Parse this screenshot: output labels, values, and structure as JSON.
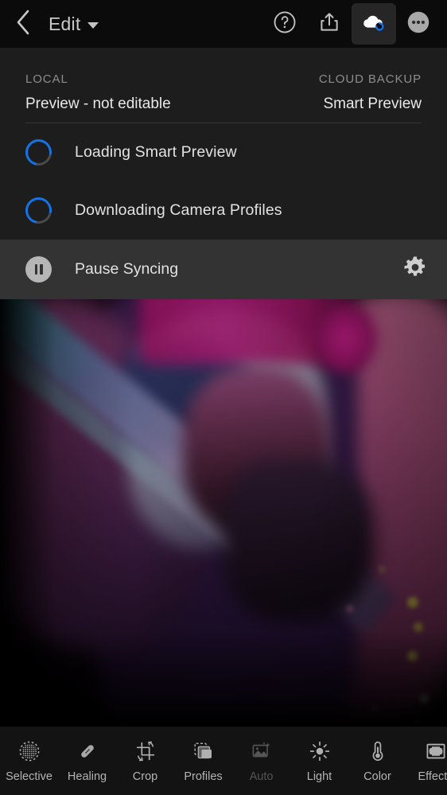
{
  "header": {
    "back_icon": "chevron-left-icon",
    "title": "Edit",
    "dropdown_icon": "chevron-down-icon",
    "help_icon": "help-circle-icon",
    "share_icon": "share-export-icon",
    "cloud_icon": "cloud-sync-icon",
    "more_icon": "more-options-icon"
  },
  "sync_panel": {
    "local_label": "LOCAL",
    "local_value": "Preview - not editable",
    "cloud_label": "CLOUD BACKUP",
    "cloud_value": "Smart Preview",
    "tasks": [
      {
        "label": "Loading Smart Preview",
        "icon": "progress-spinner-icon"
      },
      {
        "label": "Downloading Camera Profiles",
        "icon": "progress-spinner-icon"
      }
    ],
    "pause": {
      "label": "Pause Syncing",
      "icon": "pause-circle-icon",
      "settings_icon": "gear-icon"
    },
    "accent_color": "#1473e6",
    "panel_color": "#1d1d1d",
    "pause_bar_color": "#333333"
  },
  "photo": {
    "alt": "guitarist on stage lit with magenta and purple light"
  },
  "toolbar": {
    "groups": [
      {
        "name": "edit-tools",
        "items": [
          {
            "label": "Selective",
            "icon": "selective-brush-icon",
            "enabled": true
          },
          {
            "label": "Healing",
            "icon": "healing-bandage-icon",
            "enabled": true
          },
          {
            "label": "Crop",
            "icon": "crop-rotate-icon",
            "enabled": true
          },
          {
            "label": "Profiles",
            "icon": "profiles-stack-icon",
            "enabled": true
          }
        ]
      },
      {
        "name": "adjust-tools",
        "items": [
          {
            "label": "Auto",
            "icon": "auto-magic-icon",
            "enabled": false
          },
          {
            "label": "Light",
            "icon": "light-sun-icon",
            "enabled": true
          },
          {
            "label": "Color",
            "icon": "color-thermometer-icon",
            "enabled": true
          },
          {
            "label": "Effects",
            "icon": "effects-frame-icon",
            "enabled": true
          }
        ]
      }
    ]
  }
}
